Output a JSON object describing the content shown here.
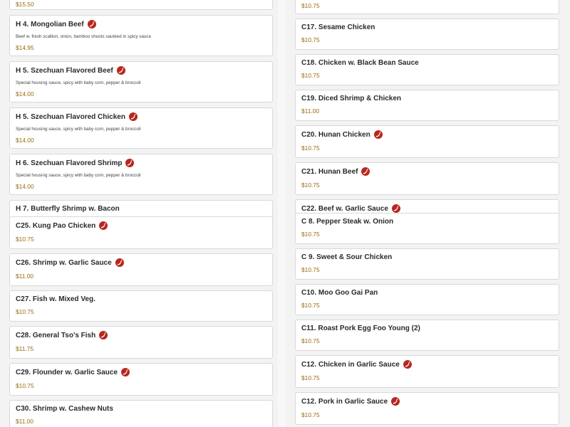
{
  "left_column": {
    "items": [
      {
        "id": "item-top",
        "price": "$15.50"
      },
      {
        "id": "item-h4",
        "name": "H 4. Mongolian Beef",
        "spicy": true,
        "desc": "Beef w. fresh scallion, onion, bamboo shoots sautéed in spicy sauce",
        "price": "$14.95"
      },
      {
        "id": "item-h5-beef",
        "name": "H 5. Szechuan Flavored Beef",
        "spicy": true,
        "desc": "Special housing sauce, spicy with baby corn, pepper & broccoli",
        "price": "$14.00"
      },
      {
        "id": "item-h5-chicken",
        "name": "H 5. Szechuan Flavored Chicken",
        "spicy": true,
        "desc": "Special housing sauce, spicy with baby corn, pepper & broccoli",
        "price": "$14.00"
      },
      {
        "id": "item-h6-shrimp",
        "name": "H 6. Szechuan Flavored Shrimp",
        "spicy": true,
        "desc": "Special housing sauce, spicy with baby corn, pepper & broccoli",
        "price": "$14.00"
      },
      {
        "id": "item-h7",
        "name": "H 7. Butterfly Shrimp w. Bacon"
      },
      {
        "id": "item-c25",
        "name": "C25. Kung Pao Chicken",
        "spicy": true,
        "price": "$10.75"
      },
      {
        "id": "item-c26",
        "name": "C26. Shrimp w. Garlic Sauce",
        "spicy": true,
        "price": "$11.00"
      },
      {
        "id": "item-c27",
        "name": "C27. Fish w. Mixed Veg.",
        "price": "$10.75"
      },
      {
        "id": "item-c28",
        "name": "C28. General Tso's Fish",
        "spicy": true,
        "price": "$11.75"
      },
      {
        "id": "item-c29",
        "name": "C29. Flounder w. Garlic Sauce",
        "spicy": true,
        "price": "$10.75"
      },
      {
        "id": "item-c30",
        "name": "C30. Shrimp w. Cashew Nuts",
        "price": "$11.00"
      }
    ]
  },
  "right_column": {
    "items": [
      {
        "id": "item-rtop",
        "price": "$10.75"
      },
      {
        "id": "item-c17",
        "name": "C17. Sesame Chicken",
        "price": "$10.75"
      },
      {
        "id": "item-c18",
        "name": "C18. Chicken w. Black Bean Sauce",
        "price": "$10.75"
      },
      {
        "id": "item-c19",
        "name": "C19. Diced Shrimp & Chicken",
        "price": "$11.00"
      },
      {
        "id": "item-c20",
        "name": "C20. Hunan Chicken",
        "spicy": true,
        "price": "$10.75"
      },
      {
        "id": "item-c21",
        "name": "C21. Hunan Beef",
        "spicy": true,
        "price": "$10.75"
      },
      {
        "id": "item-c22",
        "name": "C22. Beef w. Garlic Sauce",
        "spicy": true
      },
      {
        "id": "item-c8",
        "name": "C 8. Pepper Steak w. Onion",
        "price": "$10.75"
      },
      {
        "id": "item-c9",
        "name": "C 9. Sweet & Sour Chicken",
        "price": "$10.75"
      },
      {
        "id": "item-c10",
        "name": "C10. Moo Goo Gai Pan",
        "price": "$10.75"
      },
      {
        "id": "item-c11",
        "name": "C11. Roast Pork Egg Foo Young (2)",
        "price": "$10.75"
      },
      {
        "id": "item-c12-chicken",
        "name": "C12. Chicken in Garlic Sauce",
        "spicy": true,
        "price": "$10.75"
      },
      {
        "id": "item-c12-pork",
        "name": "C12. Pork in Garlic Sauce",
        "spicy": true,
        "price": "$10.75"
      }
    ]
  },
  "colors": {
    "price": "#9a6b12",
    "spicy_icon": "#b8271f",
    "card_border": "#d8d8d8"
  },
  "icons": {
    "spicy": "chili-pepper-icon"
  }
}
